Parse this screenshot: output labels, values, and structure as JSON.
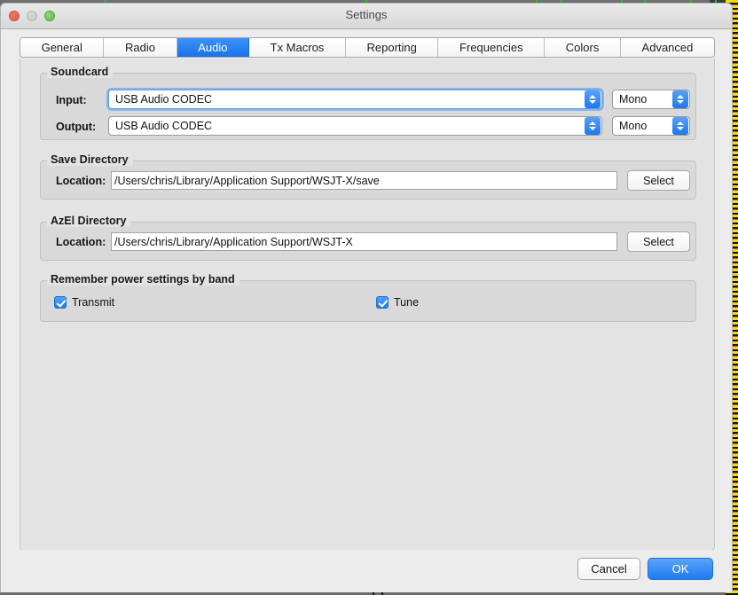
{
  "window": {
    "title": "Settings",
    "controls": {
      "close": "close-button",
      "minimize": "minimize-button",
      "zoom": "zoom-button"
    }
  },
  "tabs": [
    {
      "label": "General",
      "active": false
    },
    {
      "label": "Radio",
      "active": false
    },
    {
      "label": "Audio",
      "active": true
    },
    {
      "label": "Tx Macros",
      "active": false
    },
    {
      "label": "Reporting",
      "active": false
    },
    {
      "label": "Frequencies",
      "active": false
    },
    {
      "label": "Colors",
      "active": false
    },
    {
      "label": "Advanced",
      "active": false
    }
  ],
  "soundcard": {
    "title": "Soundcard",
    "input_label": "Input:",
    "input_device": "USB Audio CODEC",
    "input_channel": "Mono",
    "output_label": "Output:",
    "output_device": "USB Audio CODEC",
    "output_channel": "Mono"
  },
  "save_directory": {
    "title": "Save Directory",
    "location_label": "Location:",
    "location_value": "/Users/chris/Library/Application Support/WSJT-X/save",
    "select_label": "Select"
  },
  "azel_directory": {
    "title": "AzEl Directory",
    "location_label": "Location:",
    "location_value": "/Users/chris/Library/Application Support/WSJT-X",
    "select_label": "Select"
  },
  "power_settings": {
    "title": "Remember power settings by band",
    "transmit_label": "Transmit",
    "transmit_checked": true,
    "tune_label": "Tune",
    "tune_checked": true
  },
  "buttons": {
    "cancel_label": "Cancel",
    "ok_label": "OK"
  },
  "colors": {
    "accent_blue": "#1f7bf0",
    "tab_active_blue": "#1873ea",
    "window_bg": "#ececec",
    "panel_bg": "#e3e3e3",
    "group_bg": "#d9d9d9",
    "field_white": "#ffffff",
    "traffic_close": "#e0574b",
    "traffic_min": "#c6c6c6",
    "traffic_max": "#5cb84c"
  }
}
